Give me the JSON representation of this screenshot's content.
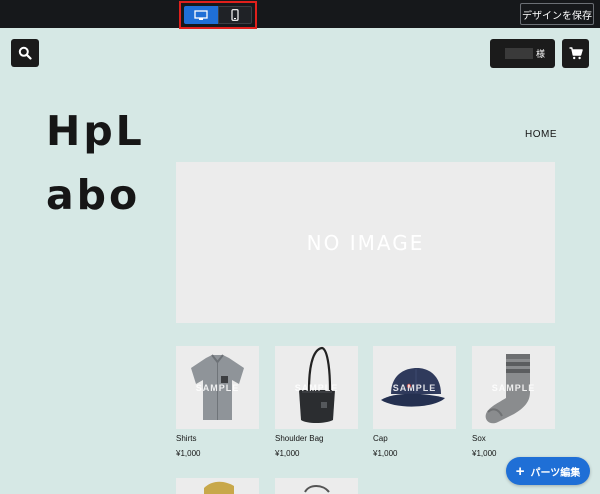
{
  "toolbar": {
    "device_modes": [
      "desktop",
      "mobile"
    ],
    "active_mode": "desktop",
    "save_label": "デザインを保存"
  },
  "header": {
    "search_icon": "search-icon",
    "user_suffix": "様",
    "cart_icon": "cart-icon"
  },
  "logo": {
    "line1": "HpL",
    "line2": "abo"
  },
  "nav": {
    "home": "HOME"
  },
  "hero": {
    "placeholder": "NO IMAGE"
  },
  "products": [
    {
      "name": "Shirts",
      "price": "¥1,000",
      "badge": "SAMPLE"
    },
    {
      "name": "Shoulder Bag",
      "price": "¥1,000",
      "badge": "SAMPLE"
    },
    {
      "name": "Cap",
      "price": "¥1,000",
      "badge": "SAMPLE"
    },
    {
      "name": "Sox",
      "price": "¥1,000",
      "badge": "SAMPLE"
    }
  ],
  "fab": {
    "icon": "+",
    "label": "パーツ編集"
  },
  "colors": {
    "page_background": "#d6e8e5",
    "toolbar": "#16181b",
    "accent_blue": "#1f6fd6",
    "highlight_red": "#e0201c"
  }
}
